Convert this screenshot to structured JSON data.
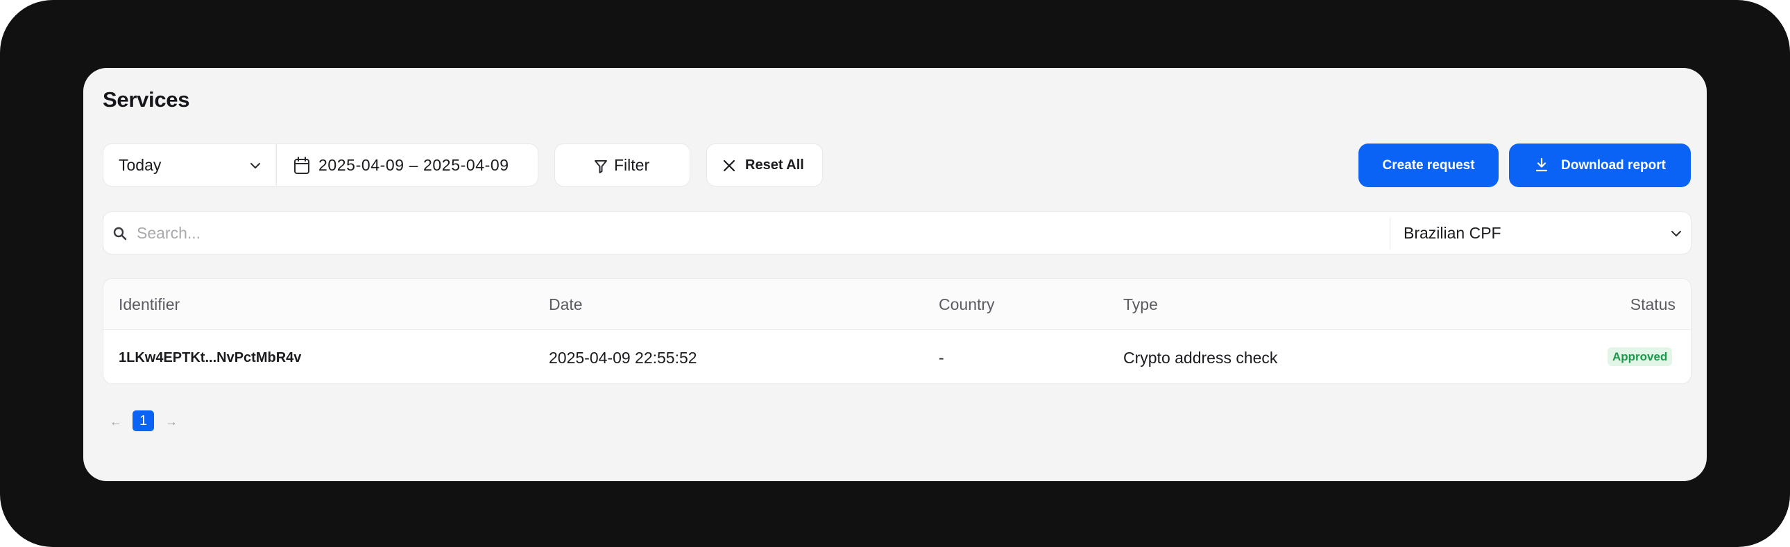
{
  "page": {
    "title": "Services"
  },
  "toolbar": {
    "period": "Today",
    "date_range": "2025-04-09 – 2025-04-09",
    "filter_label": "Filter",
    "reset_label": "Reset All",
    "create_label": "Create request",
    "download_label": "Download report"
  },
  "search": {
    "placeholder": "Search...",
    "value": "",
    "document_type": "Brazilian CPF"
  },
  "table": {
    "columns": [
      "Identifier",
      "Date",
      "Country",
      "Type",
      "Status"
    ],
    "rows": [
      {
        "identifier": "1LKw4EPTKt...NvPctMbR4v",
        "date": "2025-04-09 22:55:52",
        "country": "-",
        "type": "Crypto address check",
        "status": "Approved"
      }
    ]
  },
  "pagination": {
    "current_page": "1",
    "prev": "←",
    "next": "→"
  },
  "colors": {
    "accent": "#0b63f6",
    "frame": "#111111",
    "card": "#f4f4f4",
    "status_approved_bg": "#e2f6e8",
    "status_approved_text": "#1a9a4a"
  }
}
